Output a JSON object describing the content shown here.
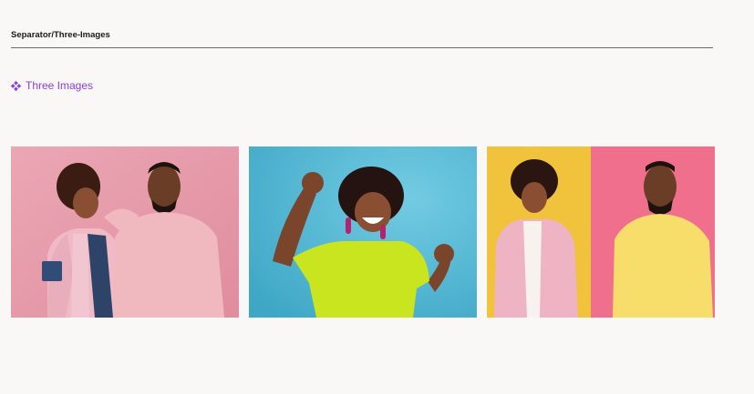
{
  "header": {
    "title": "Separator/Three-Images"
  },
  "component": {
    "label": "Three Images",
    "icon": "component-diamond-icon",
    "color": "#8b3fe0"
  },
  "images": [
    {
      "subject": "woman in pink jacket and denim vest leaning on man in pink sweater",
      "background": "#e8a0ae"
    },
    {
      "subject": "woman in lime shirt dancing with raised fists",
      "background": "#4fb3cf"
    },
    {
      "subject": "woman in pink jacket and man in yellow sweater",
      "background_left": "#f1c23b",
      "background_right": "#ef6f8c"
    }
  ]
}
